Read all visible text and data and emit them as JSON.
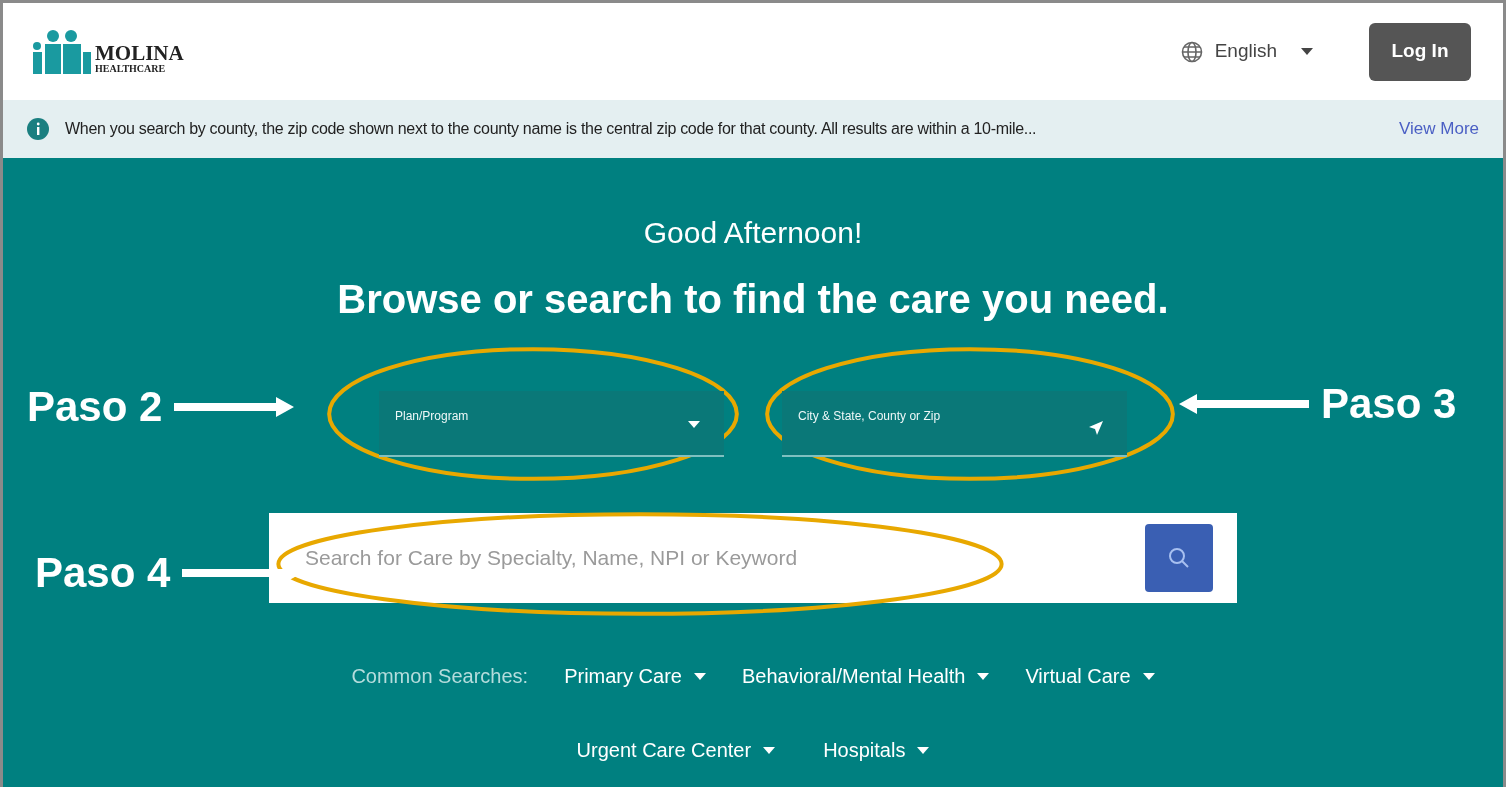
{
  "header": {
    "logo": {
      "name": "MOLINA",
      "tagline": "HEALTHCARE"
    },
    "language": "English",
    "login_button": "Log In"
  },
  "banner": {
    "text": "When you search by county, the zip code shown next to the county name is the central zip code for that county. All results are within a 10-mile...",
    "link": "View More"
  },
  "hero": {
    "greeting": "Good Afternoon!",
    "headline": "Browse or search to find the care you need."
  },
  "fields": [
    {
      "kind": "dropdown",
      "label": "Plan/Program"
    },
    {
      "kind": "location",
      "label": "City & State, County or Zip"
    }
  ],
  "search": {
    "placeholder": "Search for Care by Specialty, Name, NPI or Keyword"
  },
  "common_searches": {
    "label": "Common Searches:",
    "items": [
      "Primary Care",
      "Behavioral/Mental Health",
      "Virtual Care",
      "Urgent Care Center",
      "Hospitals"
    ]
  },
  "annotations": [
    {
      "label": "Paso 2"
    },
    {
      "label": "Paso 3"
    },
    {
      "label": "Paso 4"
    }
  ]
}
